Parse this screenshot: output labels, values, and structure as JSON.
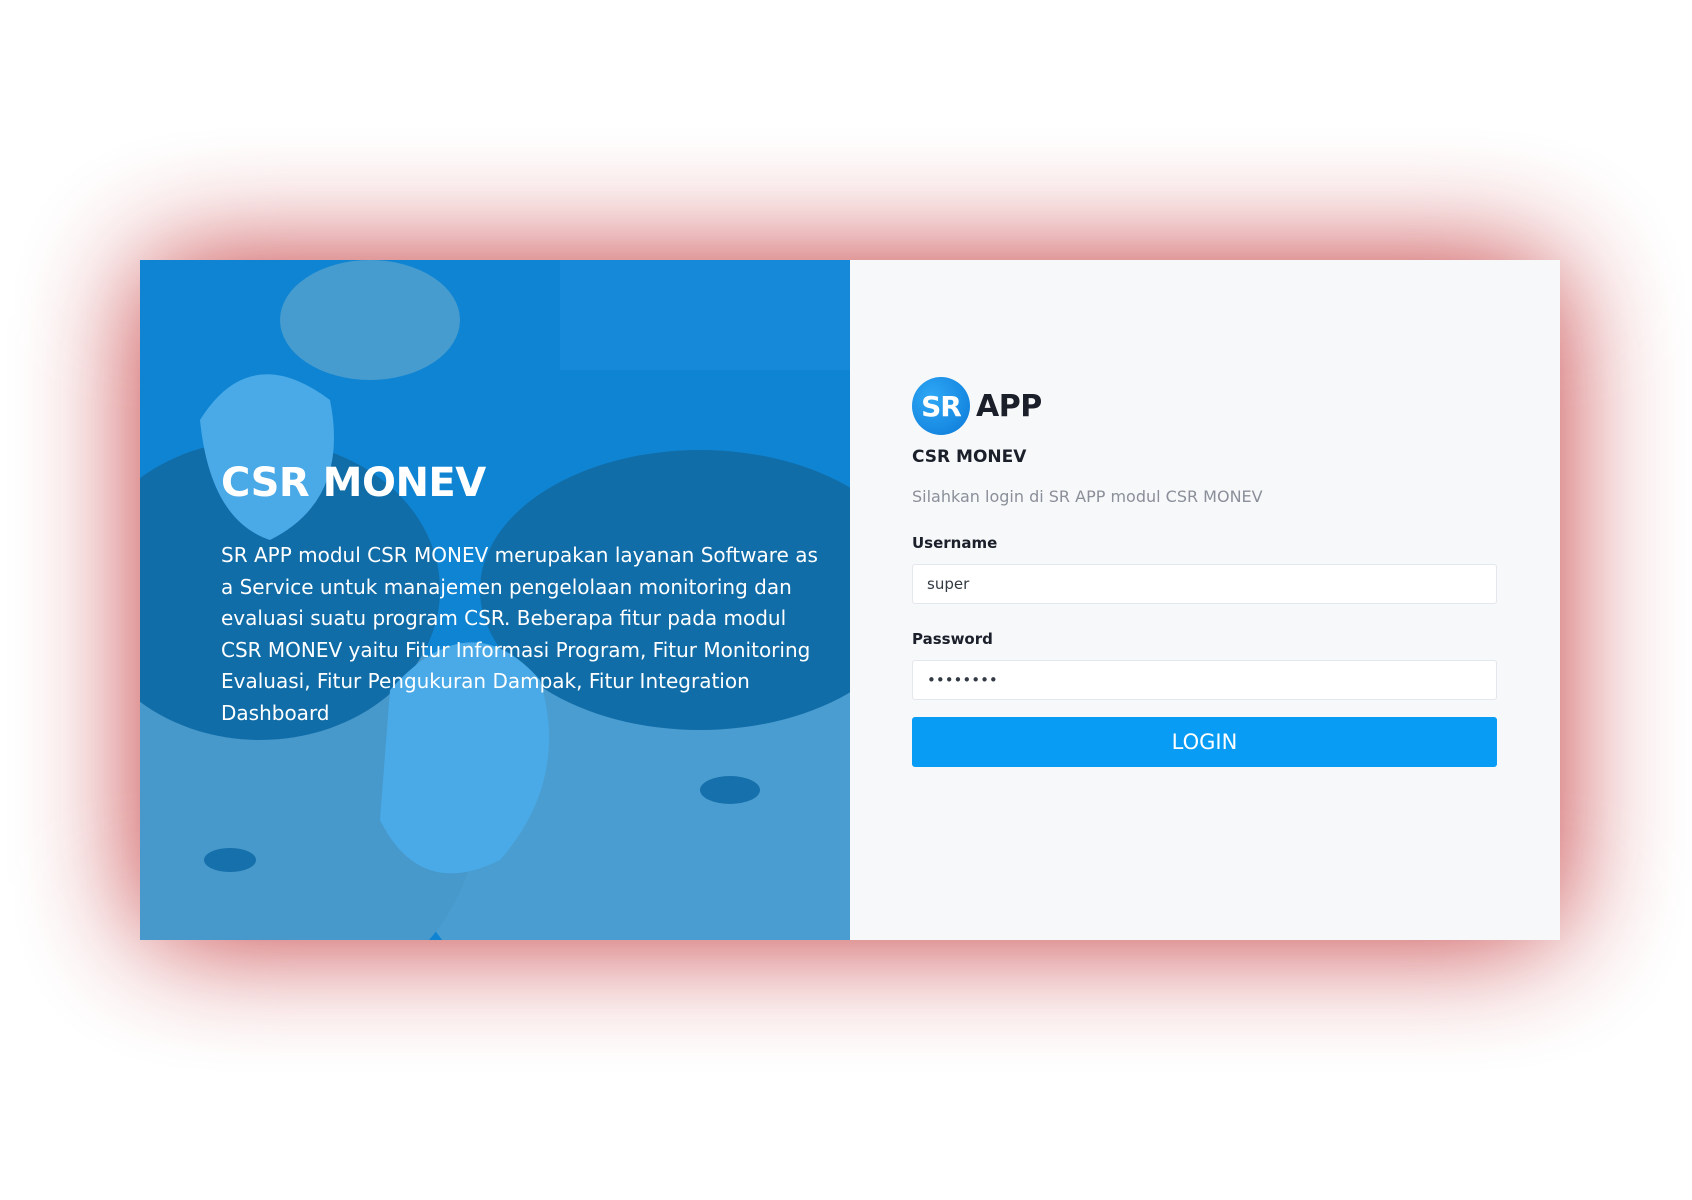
{
  "hero": {
    "title": "CSR MONEV",
    "description": "SR APP modul CSR MONEV merupakan layanan Software as a Service untuk manajemen pengelolaan monitoring dan evaluasi suatu program CSR. Beberapa fitur pada modul CSR MONEV yaitu Fitur Informasi Program, Fitur Monitoring Evaluasi, Fitur Pengukuran Dampak, Fitur Integration Dashboard"
  },
  "brand": {
    "badge": "SR",
    "word": "APP",
    "module": "CSR MONEV"
  },
  "login": {
    "subtitle": "Silahkan login di SR APP modul CSR MONEV",
    "username_label": "Username",
    "username_value": "super",
    "password_label": "Password",
    "password_value": "••••••••",
    "submit_label": "LOGIN"
  },
  "colors": {
    "accent": "#089cf5",
    "hero_overlay": "#0c8ee0",
    "glow": "#c0282b",
    "panel_bg": "#f7f8fa"
  }
}
